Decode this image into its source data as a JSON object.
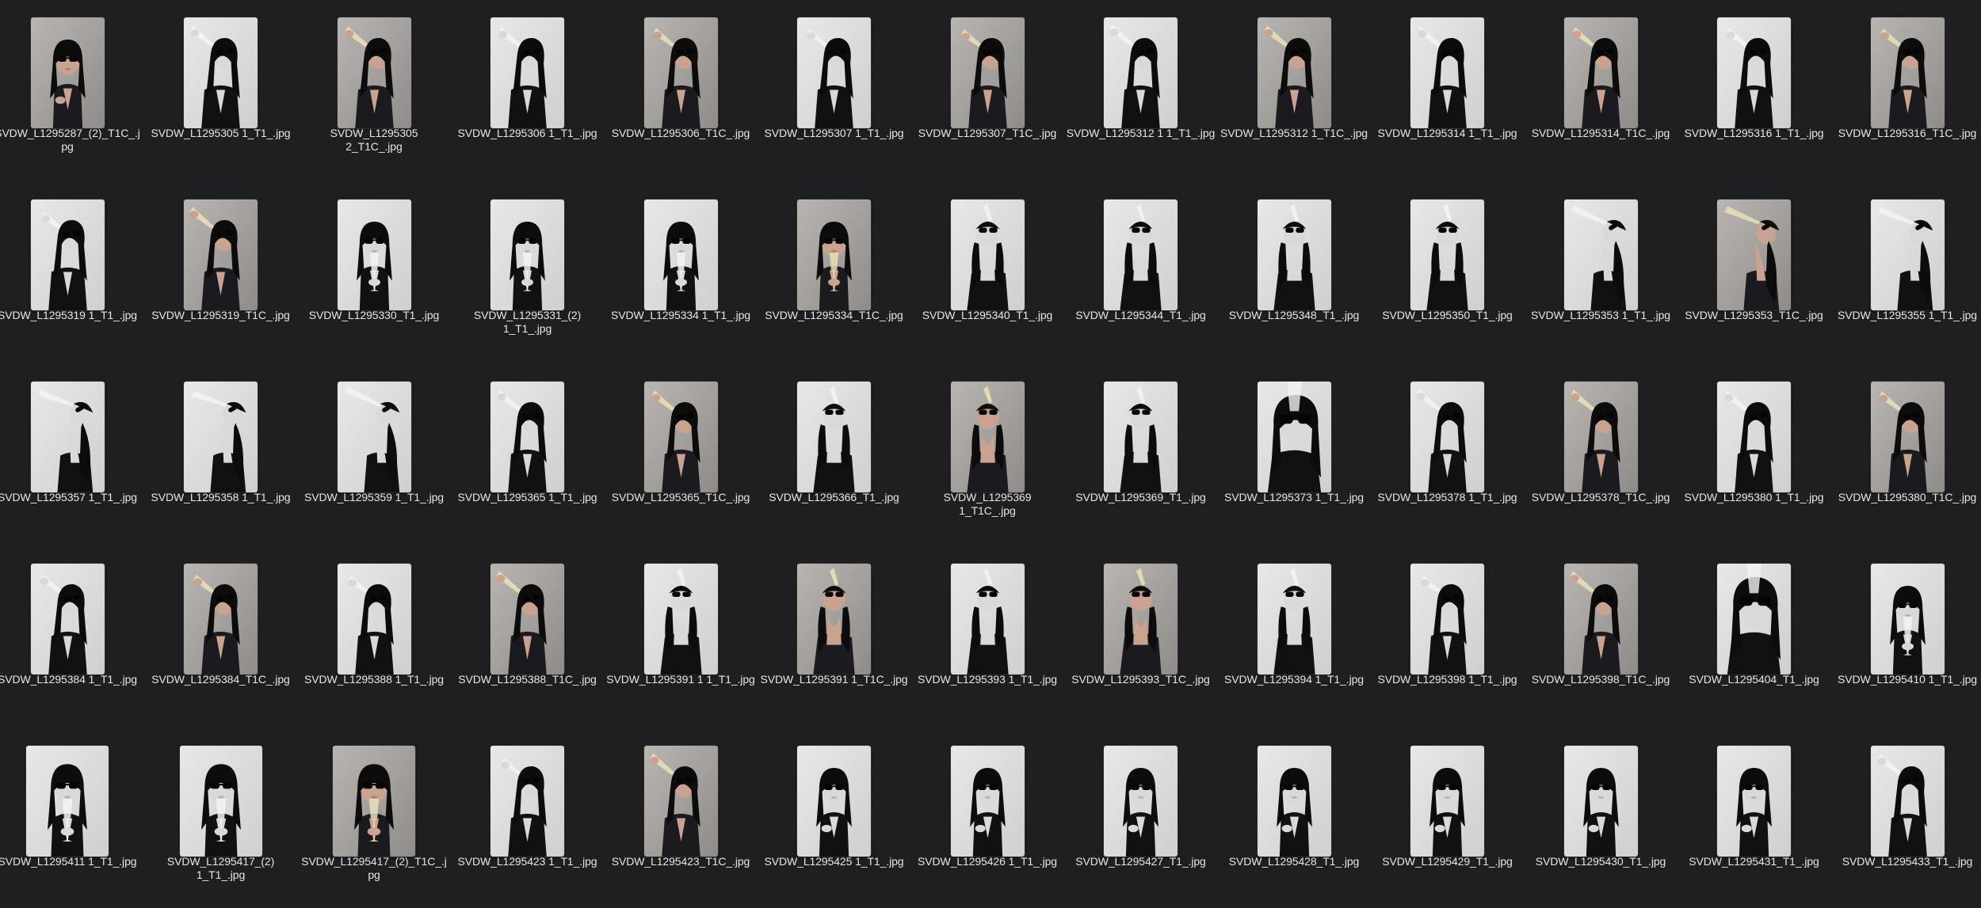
{
  "window": {
    "view": "icon-grid",
    "background": "#1f1f21"
  },
  "files": [
    {
      "name": "SVDW_L1295287_(2)_T1C_.j\npg",
      "pose": "front",
      "tone": "warm"
    },
    {
      "name": "SVDW_L1295305 1_T1_.jpg",
      "pose": "drink",
      "tone": "mono"
    },
    {
      "name": "SVDW_L1295305\n2_T1C_.jpg",
      "pose": "drink",
      "tone": "warm"
    },
    {
      "name": "SVDW_L1295306 1_T1_.jpg",
      "pose": "drink",
      "tone": "mono"
    },
    {
      "name": "SVDW_L1295306_T1C_.jpg",
      "pose": "drink",
      "tone": "warm"
    },
    {
      "name": "SVDW_L1295307 1_T1_.jpg",
      "pose": "drink",
      "tone": "mono"
    },
    {
      "name": "SVDW_L1295307_T1C_.jpg",
      "pose": "drink",
      "tone": "warm"
    },
    {
      "name": "SVDW_L1295312 1 1_T1_.jpg",
      "pose": "drink",
      "tone": "mono"
    },
    {
      "name": "SVDW_L1295312 1_T1C_.jpg",
      "pose": "drink",
      "tone": "warm"
    },
    {
      "name": "SVDW_L1295314 1_T1_.jpg",
      "pose": "drink",
      "tone": "mono"
    },
    {
      "name": "SVDW_L1295314_T1C_.jpg",
      "pose": "drink",
      "tone": "warm"
    },
    {
      "name": "SVDW_L1295316 1_T1_.jpg",
      "pose": "drink",
      "tone": "mono"
    },
    {
      "name": "SVDW_L1295316_T1C_.jpg",
      "pose": "drink",
      "tone": "warm"
    },
    {
      "name": "SVDW_L1295319 1_T1_.jpg",
      "pose": "drink",
      "tone": "mono"
    },
    {
      "name": "SVDW_L1295319_T1C_.jpg",
      "pose": "drink",
      "tone": "warm"
    },
    {
      "name": "SVDW_L1295330_T1_.jpg",
      "pose": "glass",
      "tone": "mono"
    },
    {
      "name": "SVDW_L1295331_(2)\n1_T1_.jpg",
      "pose": "glass",
      "tone": "mono"
    },
    {
      "name": "SVDW_L1295334 1_T1_.jpg",
      "pose": "glass",
      "tone": "mono"
    },
    {
      "name": "SVDW_L1295334_T1C_.jpg",
      "pose": "glass",
      "tone": "warm"
    },
    {
      "name": "SVDW_L1295340_T1_.jpg",
      "pose": "tilt",
      "tone": "mono"
    },
    {
      "name": "SVDW_L1295344_T1_.jpg",
      "pose": "tilt",
      "tone": "mono"
    },
    {
      "name": "SVDW_L1295348_T1_.jpg",
      "pose": "tilt",
      "tone": "mono"
    },
    {
      "name": "SVDW_L1295350_T1_.jpg",
      "pose": "tilt",
      "tone": "mono"
    },
    {
      "name": "SVDW_L1295353 1_T1_.jpg",
      "pose": "side",
      "tone": "mono"
    },
    {
      "name": "SVDW_L1295353_T1C_.jpg",
      "pose": "side",
      "tone": "warm"
    },
    {
      "name": "SVDW_L1295355 1_T1_.jpg",
      "pose": "side",
      "tone": "mono"
    },
    {
      "name": "SVDW_L1295357 1_T1_.jpg",
      "pose": "side",
      "tone": "mono"
    },
    {
      "name": "SVDW_L1295358 1_T1_.jpg",
      "pose": "side",
      "tone": "mono"
    },
    {
      "name": "SVDW_L1295359 1_T1_.jpg",
      "pose": "side",
      "tone": "mono"
    },
    {
      "name": "SVDW_L1295365 1_T1_.jpg",
      "pose": "drink",
      "tone": "mono"
    },
    {
      "name": "SVDW_L1295365_T1C_.jpg",
      "pose": "drink",
      "tone": "warm"
    },
    {
      "name": "SVDW_L1295366_T1_.jpg",
      "pose": "tilt",
      "tone": "mono"
    },
    {
      "name": "SVDW_L1295369\n1_T1C_.jpg",
      "pose": "tilt",
      "tone": "warm"
    },
    {
      "name": "SVDW_L1295369_T1_.jpg",
      "pose": "tilt",
      "tone": "mono"
    },
    {
      "name": "SVDW_L1295373 1_T1_.jpg",
      "pose": "close",
      "tone": "mono"
    },
    {
      "name": "SVDW_L1295378 1_T1_.jpg",
      "pose": "drink",
      "tone": "mono"
    },
    {
      "name": "SVDW_L1295378_T1C_.jpg",
      "pose": "drink",
      "tone": "warm"
    },
    {
      "name": "SVDW_L1295380 1_T1_.jpg",
      "pose": "drink",
      "tone": "mono"
    },
    {
      "name": "SVDW_L1295380_T1C_.jpg",
      "pose": "drink",
      "tone": "warm"
    },
    {
      "name": "SVDW_L1295384 1_T1_.jpg",
      "pose": "drink",
      "tone": "mono"
    },
    {
      "name": "SVDW_L1295384_T1C_.jpg",
      "pose": "drink",
      "tone": "warm"
    },
    {
      "name": "SVDW_L1295388 1_T1_.jpg",
      "pose": "drink",
      "tone": "mono"
    },
    {
      "name": "SVDW_L1295388_T1C_.jpg",
      "pose": "drink",
      "tone": "warm"
    },
    {
      "name": "SVDW_L1295391 1 1_T1_.jpg",
      "pose": "tilt",
      "tone": "mono"
    },
    {
      "name": "SVDW_L1295391 1_T1C_.jpg",
      "pose": "tilt",
      "tone": "warm"
    },
    {
      "name": "SVDW_L1295393 1_T1_.jpg",
      "pose": "tilt",
      "tone": "mono"
    },
    {
      "name": "SVDW_L1295393_T1C_.jpg",
      "pose": "tilt",
      "tone": "warm"
    },
    {
      "name": "SVDW_L1295394 1_T1_.jpg",
      "pose": "tilt",
      "tone": "mono"
    },
    {
      "name": "SVDW_L1295398 1_T1_.jpg",
      "pose": "drink",
      "tone": "mono"
    },
    {
      "name": "SVDW_L1295398_T1C_.jpg",
      "pose": "drink",
      "tone": "warm"
    },
    {
      "name": "SVDW_L1295404_T1_.jpg",
      "pose": "close",
      "tone": "mono"
    },
    {
      "name": "SVDW_L1295410 1_T1_.jpg",
      "pose": "glass",
      "tone": "mono"
    },
    {
      "name": "SVDW_L1295411 1_T1_.jpg",
      "pose": "glass",
      "tone": "mono"
    },
    {
      "name": "SVDW_L1295417_(2)\n1_T1_.jpg",
      "pose": "glass",
      "tone": "mono"
    },
    {
      "name": "SVDW_L1295417_(2)_T1C_.j\npg",
      "pose": "glass",
      "tone": "warm"
    },
    {
      "name": "SVDW_L1295423 1_T1_.jpg",
      "pose": "drink",
      "tone": "mono"
    },
    {
      "name": "SVDW_L1295423_T1C_.jpg",
      "pose": "drink",
      "tone": "warm"
    },
    {
      "name": "SVDW_L1295425 1_T1_.jpg",
      "pose": "front",
      "tone": "mono"
    },
    {
      "name": "SVDW_L1295426 1_T1_.jpg",
      "pose": "front",
      "tone": "mono"
    },
    {
      "name": "SVDW_L1295427_T1_.jpg",
      "pose": "front",
      "tone": "mono"
    },
    {
      "name": "SVDW_L1295428_T1_.jpg",
      "pose": "front",
      "tone": "mono"
    },
    {
      "name": "SVDW_L1295429_T1_.jpg",
      "pose": "front",
      "tone": "mono"
    },
    {
      "name": "SVDW_L1295430_T1_.jpg",
      "pose": "front",
      "tone": "mono"
    },
    {
      "name": "SVDW_L1295431_T1_.jpg",
      "pose": "front",
      "tone": "mono"
    },
    {
      "name": "SVDW_L1295433_T1_.jpg",
      "pose": "drink",
      "tone": "mono"
    }
  ]
}
